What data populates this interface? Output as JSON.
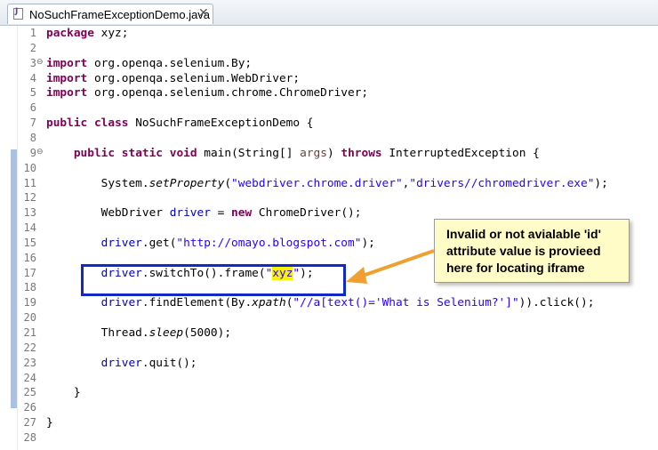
{
  "tab": {
    "title": "NoSuchFrameExceptionDemo.java",
    "icon": "java-file-icon"
  },
  "lines": [
    {
      "n": "1",
      "code": "package xyz;"
    },
    {
      "n": "2",
      "code": ""
    },
    {
      "n": "3",
      "code": "import org.openqa.selenium.By;"
    },
    {
      "n": "4",
      "code": "import org.openqa.selenium.WebDriver;"
    },
    {
      "n": "5",
      "code": "import org.openqa.selenium.chrome.ChromeDriver;"
    },
    {
      "n": "6",
      "code": ""
    },
    {
      "n": "7",
      "code": "public class NoSuchFrameExceptionDemo {"
    },
    {
      "n": "8",
      "code": ""
    },
    {
      "n": "9",
      "code": "    public static void main(String[] args) throws InterruptedException {"
    },
    {
      "n": "10",
      "code": ""
    },
    {
      "n": "11",
      "code": "        System.setProperty(\"webdriver.chrome.driver\",\"drivers//chromedriver.exe\");"
    },
    {
      "n": "12",
      "code": ""
    },
    {
      "n": "13",
      "code": "        WebDriver driver = new ChromeDriver();"
    },
    {
      "n": "14",
      "code": ""
    },
    {
      "n": "15",
      "code": "        driver.get(\"http://omayo.blogspot.com\");"
    },
    {
      "n": "16",
      "code": ""
    },
    {
      "n": "17",
      "code": "        driver.switchTo().frame(\"xyz\");"
    },
    {
      "n": "18",
      "code": ""
    },
    {
      "n": "19",
      "code": "        driver.findElement(By.xpath(\"//a[text()='What is Selenium?']\")).click();"
    },
    {
      "n": "20",
      "code": ""
    },
    {
      "n": "21",
      "code": "        Thread.sleep(5000);"
    },
    {
      "n": "22",
      "code": ""
    },
    {
      "n": "23",
      "code": "        driver.quit();"
    },
    {
      "n": "24",
      "code": ""
    },
    {
      "n": "25",
      "code": "    }"
    },
    {
      "n": "26",
      "code": ""
    },
    {
      "n": "27",
      "code": "}"
    },
    {
      "n": "28",
      "code": ""
    }
  ],
  "fold_markers": {
    "3": "⊖",
    "9": "⊖"
  },
  "callout": {
    "text": "Invalid or not avialable 'id' attribute value is provieed here for locating iframe"
  },
  "colors": {
    "keyword": "#7f0055",
    "string": "#2a00ff",
    "field": "#0000c0",
    "highlight": "#f7f200",
    "box": "#1328c8",
    "arrow": "#f0a030",
    "callout_bg": "#fffcc8"
  }
}
